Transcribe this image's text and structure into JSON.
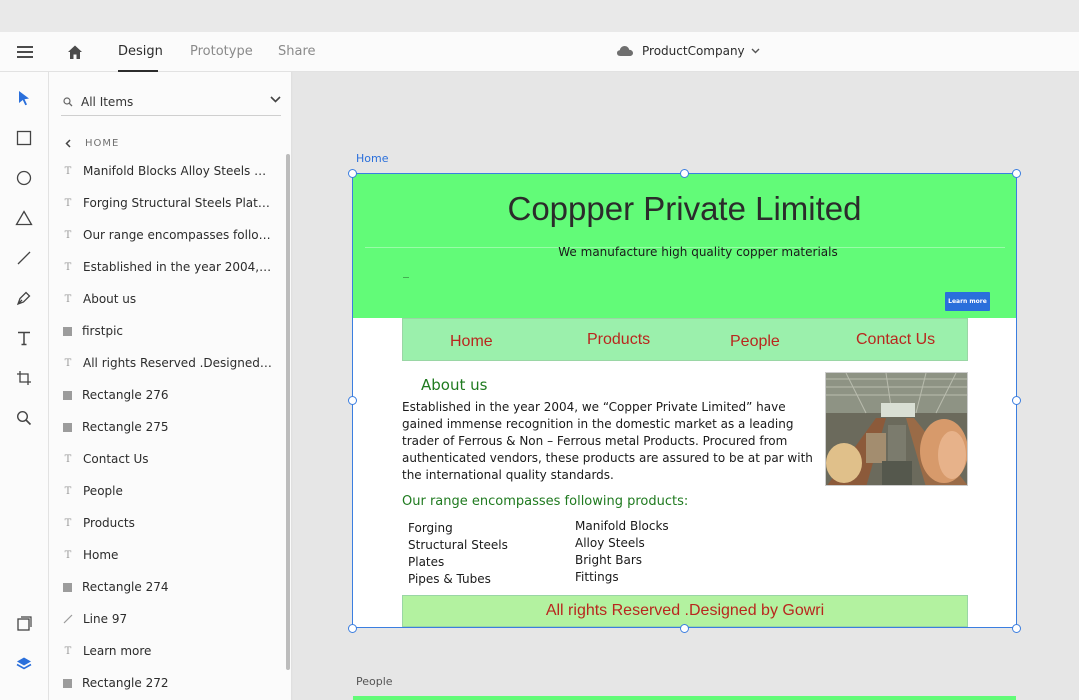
{
  "topbar": {
    "tabs": [
      {
        "label": "Design",
        "active": true
      },
      {
        "label": "Prototype",
        "active": false
      },
      {
        "label": "Share",
        "active": false
      }
    ],
    "document_name": "ProductCompany"
  },
  "toolbar": {
    "tools": [
      "select-tool",
      "rectangle-tool",
      "ellipse-tool",
      "triangle-tool",
      "line-tool",
      "pen-tool",
      "text-tool",
      "artboard-tool",
      "zoom-tool",
      "assets-tool",
      "layers-tool"
    ]
  },
  "layers_panel": {
    "search_value": "All Items",
    "breadcrumb": "HOME",
    "items": [
      {
        "label": "Manifold Blocks Alloy Steels Brig...",
        "kind": "text"
      },
      {
        "label": "Forging Structural Steels Plates...",
        "kind": "text"
      },
      {
        "label": "Our range encompasses followin...",
        "kind": "text"
      },
      {
        "label": "Established in the year 2004, we...",
        "kind": "text"
      },
      {
        "label": "About us",
        "kind": "text"
      },
      {
        "label": "firstpic",
        "kind": "rect"
      },
      {
        "label": "All rights Reserved .Designed by...",
        "kind": "text"
      },
      {
        "label": "Rectangle 276",
        "kind": "rect"
      },
      {
        "label": "Rectangle 275",
        "kind": "rect"
      },
      {
        "label": "Contact Us",
        "kind": "text"
      },
      {
        "label": "People",
        "kind": "text"
      },
      {
        "label": "Products",
        "kind": "text"
      },
      {
        "label": "Home",
        "kind": "text"
      },
      {
        "label": "Rectangle 274",
        "kind": "rect"
      },
      {
        "label": "Line 97",
        "kind": "line"
      },
      {
        "label": "Learn more",
        "kind": "text"
      },
      {
        "label": "Rectangle 272",
        "kind": "rect"
      }
    ]
  },
  "canvas": {
    "artboard_label": "Home",
    "artboard2_label": "People"
  },
  "page": {
    "title": "Coppper Private Limited",
    "subtitle": "We manufacture high quality copper materials",
    "learn_more": "Learn more",
    "nav": [
      "Home",
      "Products",
      "People",
      "Contact Us"
    ],
    "about_heading": "About us",
    "about_text": "Established in the year 2004, we “Copper Private Limited” have gained immense recognition in the domestic market as a leading trader of Ferrous & Non – Ferrous metal Products. Procured from authenticated vendors, these products are assured to be at par with the international quality standards.",
    "range_heading": "Our range encompasses following products:",
    "products_col1": [
      "Forging",
      "Structural Steels",
      "Plates",
      "Pipes & Tubes"
    ],
    "products_col2": [
      "Manifold Blocks",
      "Alloy Steels",
      "Bright Bars",
      "Fittings"
    ],
    "footer": "All rights Reserved .Designed by Gowri"
  },
  "colors": {
    "hero_green": "#62fb78",
    "nav_green": "#9bf0ac",
    "footer_green": "#b3f2a0",
    "nav_text_red": "#b9271e",
    "heading_green": "#1f7a1f",
    "selection_blue": "#3b7ee0",
    "button_blue": "#2a6fdb"
  }
}
